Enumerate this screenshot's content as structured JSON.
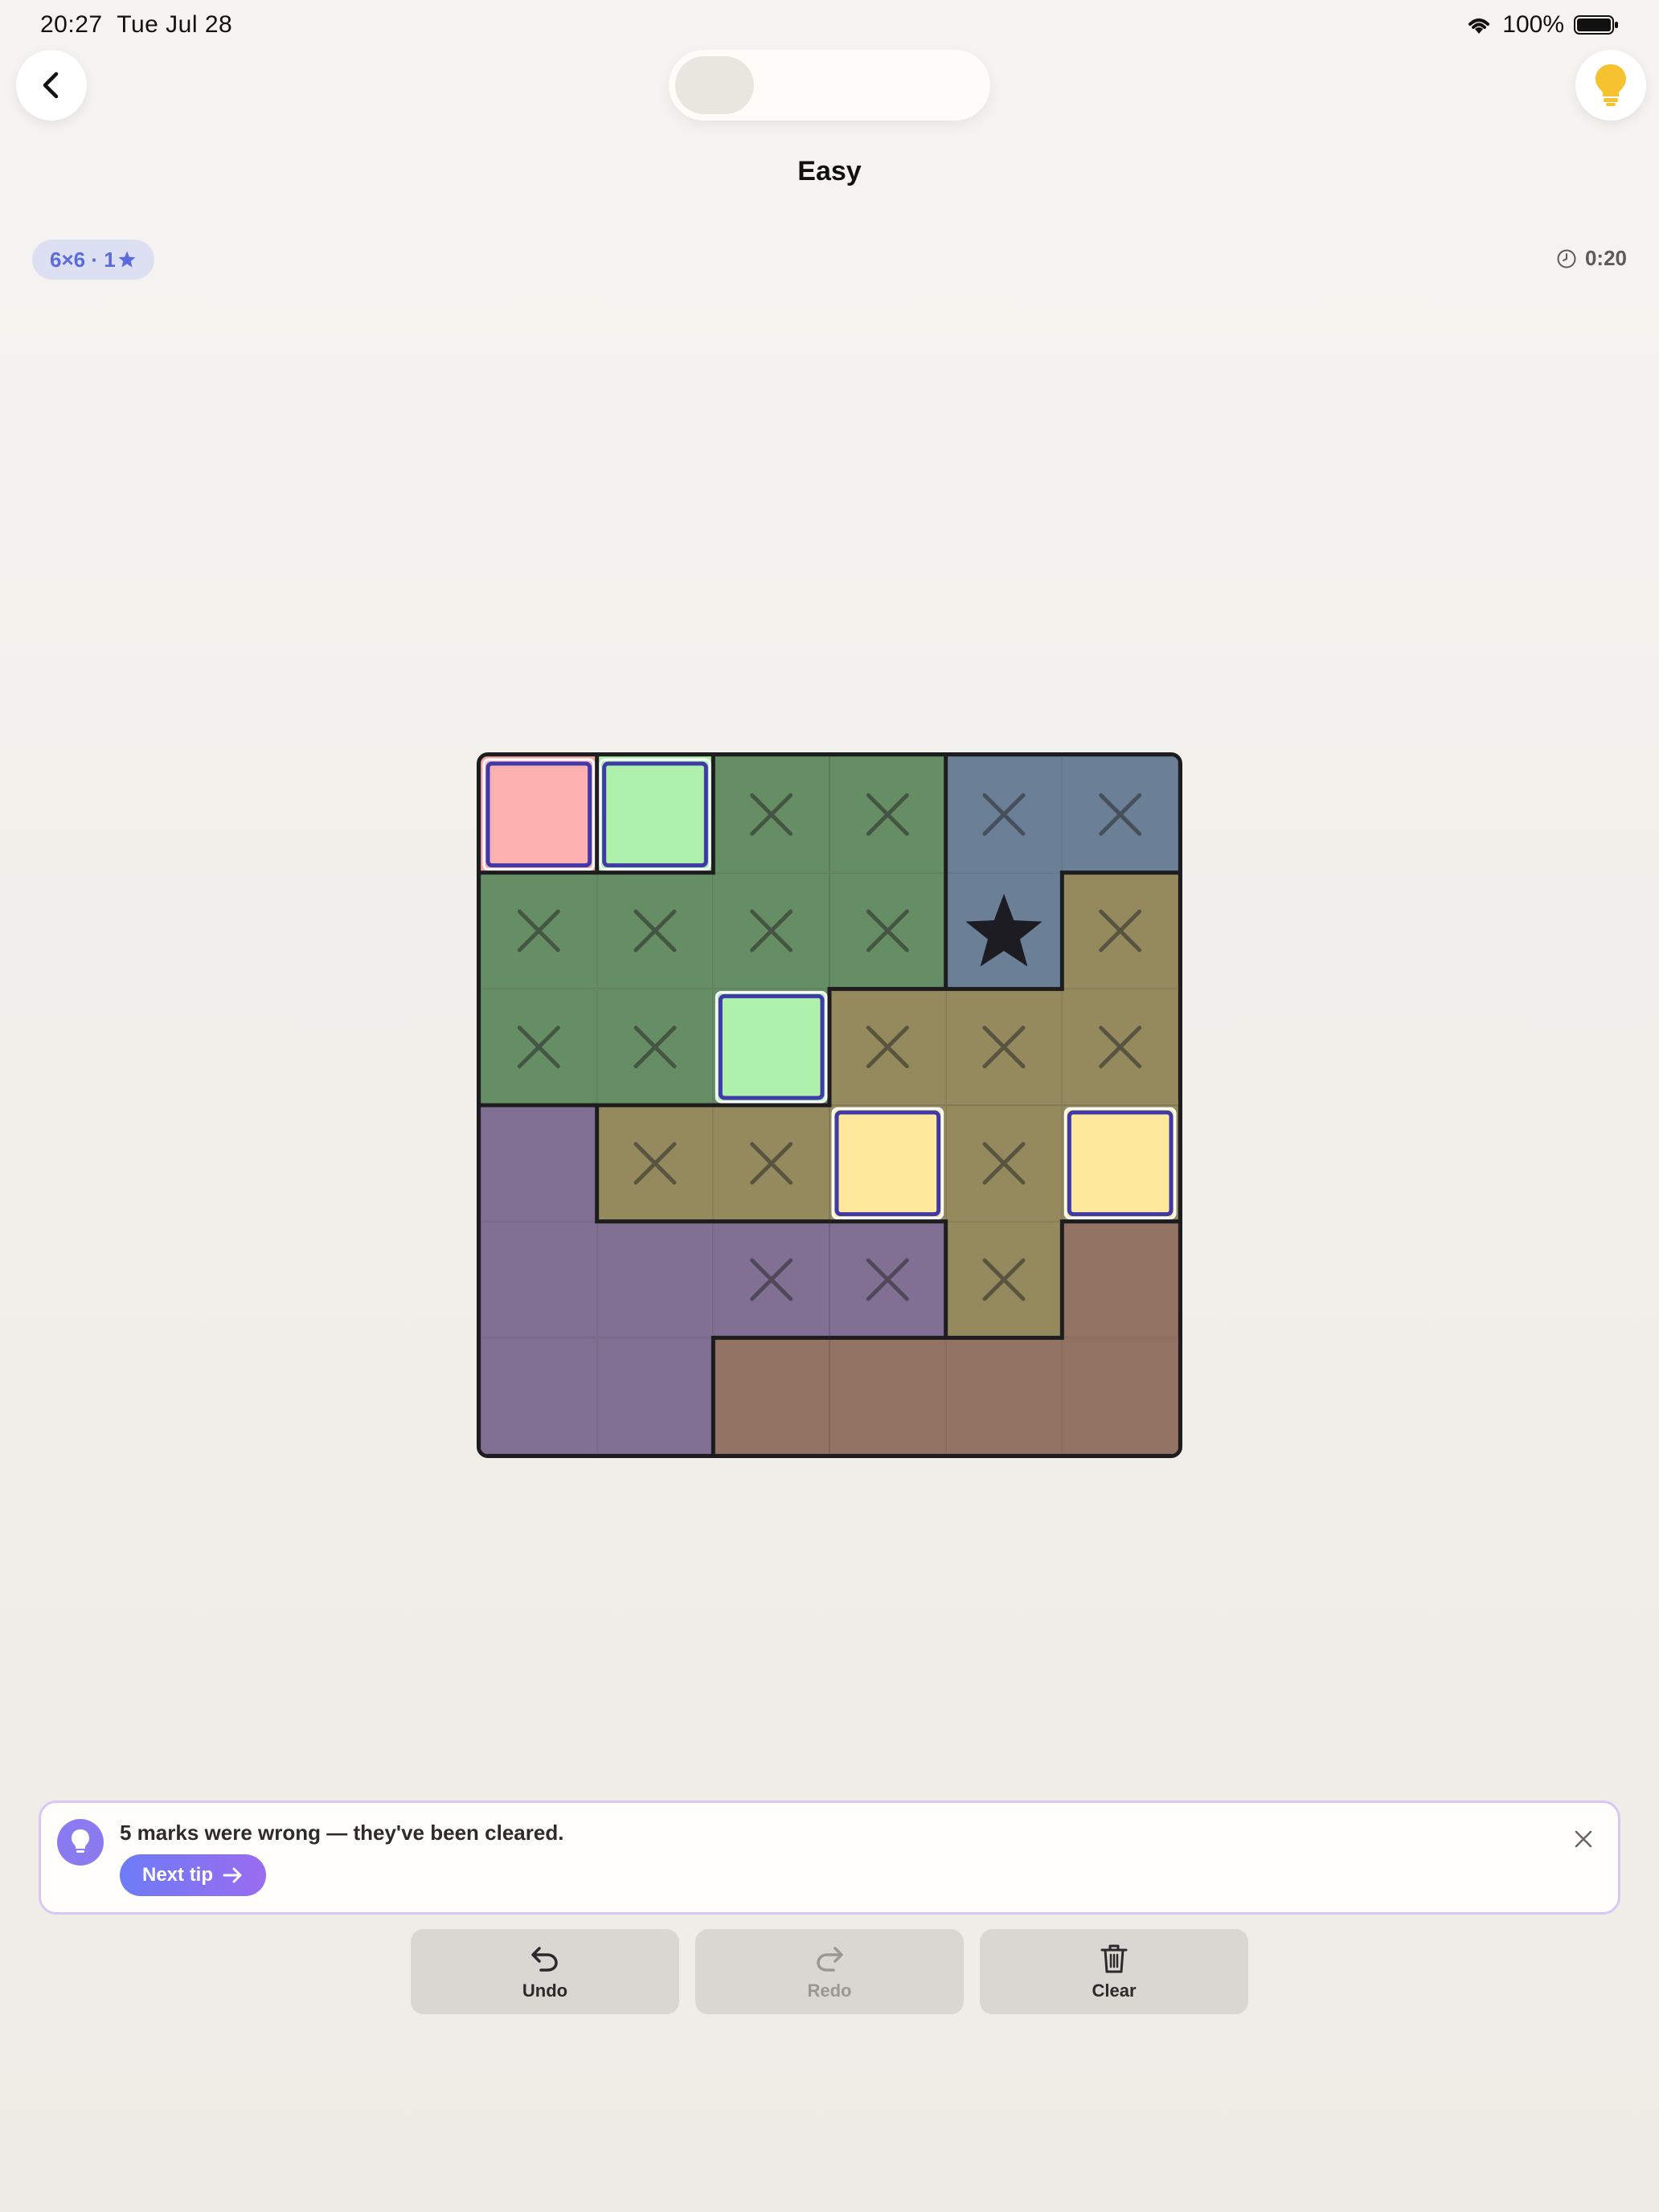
{
  "status": {
    "time": "20:27",
    "date": "Tue Jul 28",
    "battery": "100%"
  },
  "header": {
    "difficulty": "Easy",
    "back_icon": "chevron-left-icon",
    "hint_icon": "lightbulb-icon"
  },
  "info": {
    "badge_text": "6×6 · 1",
    "timer": "0:20"
  },
  "board": {
    "size": 6,
    "regions": [
      [
        "pink",
        "lime",
        "green",
        "green",
        "slate",
        "slate"
      ],
      [
        "green",
        "green",
        "green",
        "green",
        "slate",
        "olive"
      ],
      [
        "green",
        "green",
        "green",
        "olive",
        "olive",
        "olive"
      ],
      [
        "purple",
        "olive",
        "olive",
        "olive",
        "olive",
        "olive"
      ],
      [
        "purple",
        "purple",
        "purple",
        "purple",
        "olive",
        "brown"
      ],
      [
        "purple",
        "purple",
        "brown",
        "brown",
        "brown",
        "brown"
      ]
    ],
    "marks": [
      [
        "fill-pink",
        "fill-green",
        "x",
        "x",
        "x",
        "x"
      ],
      [
        "x",
        "x",
        "x",
        "x",
        "star",
        "x"
      ],
      [
        "x",
        "x",
        "fill-green",
        "x",
        "x",
        "x"
      ],
      [
        "",
        "x",
        "x",
        "fill-yellow",
        "x",
        "fill-yellow"
      ],
      [
        "",
        "",
        "x",
        "x",
        "x",
        ""
      ],
      [
        "",
        "",
        "",
        "",
        "",
        ""
      ]
    ],
    "colors": {
      "pink": "#f4a9a9",
      "lime": "#acefa9",
      "green": "#668e65",
      "slate": "#6b8097",
      "olive": "#958a5e",
      "purple": "#817093",
      "brown": "#937363",
      "fill-pink": "#fdb0b0",
      "fill-green": "#adf1ad",
      "fill-yellow": "#fde89c"
    }
  },
  "tip": {
    "message": "5 marks were wrong — they've been cleared.",
    "button_label": "Next tip"
  },
  "actions": {
    "undo_label": "Undo",
    "redo_label": "Redo",
    "clear_label": "Clear"
  }
}
